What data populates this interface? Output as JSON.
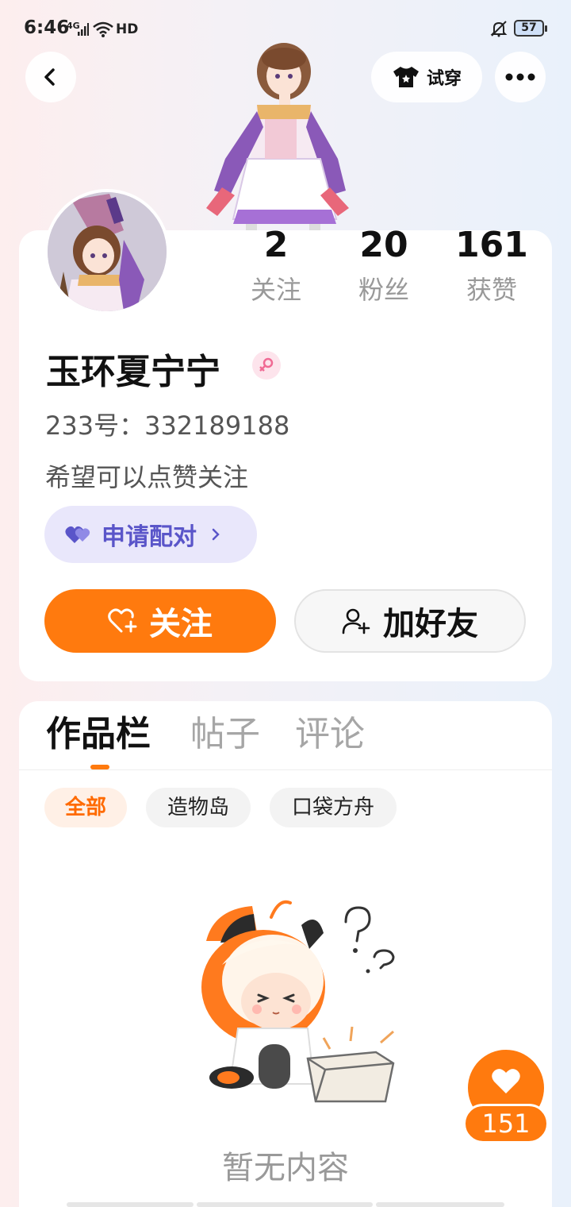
{
  "status_bar": {
    "time": "6:46",
    "network": "4G",
    "hd": "HD",
    "battery": "57"
  },
  "header": {
    "tryon_label": "试穿"
  },
  "profile": {
    "stats": [
      {
        "value": "2",
        "label": "关注"
      },
      {
        "value": "20",
        "label": "粉丝"
      },
      {
        "value": "161",
        "label": "获赞"
      }
    ],
    "nickname": "玉环夏宁宁",
    "gender": "female",
    "uid": "233号：332189188",
    "bio": "希望可以点赞关注",
    "pair_label": "申请配对",
    "follow_label": "关注",
    "add_friend_label": "加好友"
  },
  "works": {
    "tabs": [
      "作品栏",
      "帖子",
      "评论"
    ],
    "filters": [
      "全部",
      "造物岛",
      "口袋方舟"
    ],
    "empty_text": "暂无内容"
  },
  "like_float": {
    "count": "151"
  },
  "colors": {
    "accent": "#ff7a0e",
    "pair_purple": "#5a55c9"
  }
}
